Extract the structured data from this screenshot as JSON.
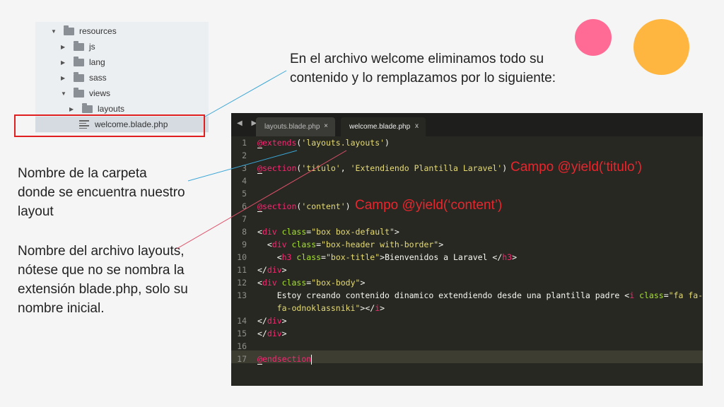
{
  "tree": {
    "items": [
      {
        "label": "resources",
        "type": "folder",
        "expanded": true
      },
      {
        "label": "js",
        "type": "folder",
        "expanded": false
      },
      {
        "label": "lang",
        "type": "folder",
        "expanded": false
      },
      {
        "label": "sass",
        "type": "folder",
        "expanded": false
      },
      {
        "label": "views",
        "type": "folder",
        "expanded": true
      },
      {
        "label": "layouts",
        "type": "folder",
        "expanded": false
      },
      {
        "label": "welcome.blade.php",
        "type": "file",
        "selected": true
      }
    ]
  },
  "notes": {
    "top": "En el archivo welcome eliminamos todo su contenido y lo remplazamos por lo siguiente:",
    "folder": "Nombre de la carpeta donde se encuentra nuestro layout",
    "file": "Nombre del archivo layouts, nótese que no se nombra la extensión blade.php, solo su nombre inicial."
  },
  "editor": {
    "tabs": [
      {
        "label": "layouts.blade.php",
        "close": "×",
        "active": false
      },
      {
        "label": "welcome.blade.php",
        "close": "x",
        "active": true
      }
    ],
    "nav_arrows": "◀ ▶",
    "line_numbers": [
      "1",
      "2",
      "3",
      "4",
      "5",
      "6",
      "7",
      "8",
      "9",
      "10",
      "11",
      "12",
      "13",
      "",
      "14",
      "15",
      "16",
      "17"
    ]
  },
  "annotations": {
    "campo_titulo": "Campo @yield(‘titulo’)",
    "campo_content": "Campo @yield(‘content’)"
  },
  "colors": {
    "editor_bg": "#272822",
    "keyword": "#f92672",
    "string": "#e6db74",
    "attribute": "#a6e22e",
    "annotation_red": "#e8262e",
    "circle_pink": "#ff6b95",
    "circle_orange": "#ffb640"
  },
  "icons": [
    "folder-icon",
    "file-lines-icon",
    "chevron-down-icon",
    "chevron-right-icon",
    "close-icon"
  ]
}
